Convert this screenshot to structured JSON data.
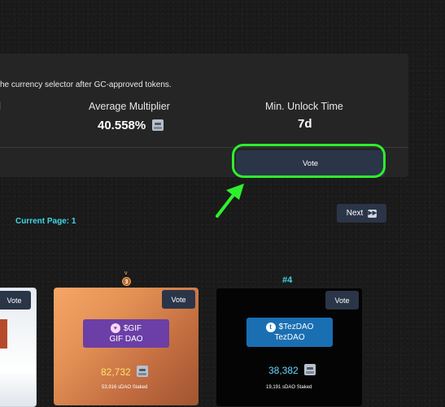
{
  "panel": {
    "notice": "he currency selector after GC-approved tokens.",
    "left_fragment": "d",
    "avg_multiplier_label": "Average Multiplier",
    "avg_multiplier_value": "40.558%",
    "min_unlock_label": "Min. Unlock Time",
    "min_unlock_value": "7d",
    "vote_label": "Vote"
  },
  "pagination": {
    "current_page": "Current Page: 1",
    "next_label": "Next"
  },
  "cards": [
    {
      "rank": "",
      "vote_label": "Vote"
    },
    {
      "rank": "3",
      "vote_label": "Vote",
      "symbol": "$GIF",
      "name": "GIF DAO",
      "amount": "82,732",
      "staked": "53,916 sDAO Staked"
    },
    {
      "rank": "#4",
      "vote_label": "Vote",
      "symbol": "$TezDAO",
      "name": "TezDAO",
      "amount": "38,382",
      "staked": "19,191 sDAO Staked"
    }
  ],
  "colors": {
    "accent_cyan": "#42d7e6",
    "highlight_green": "#2df02d",
    "button_bg": "#2b3548",
    "gif_badge": "#6b3fa6",
    "tez_badge": "#1a6fb3"
  },
  "icons": [
    "robot-icon",
    "fast-forward-icon",
    "green-arrow-icon",
    "medal-icon",
    "gif-logo-icon",
    "tez-logo-icon"
  ]
}
